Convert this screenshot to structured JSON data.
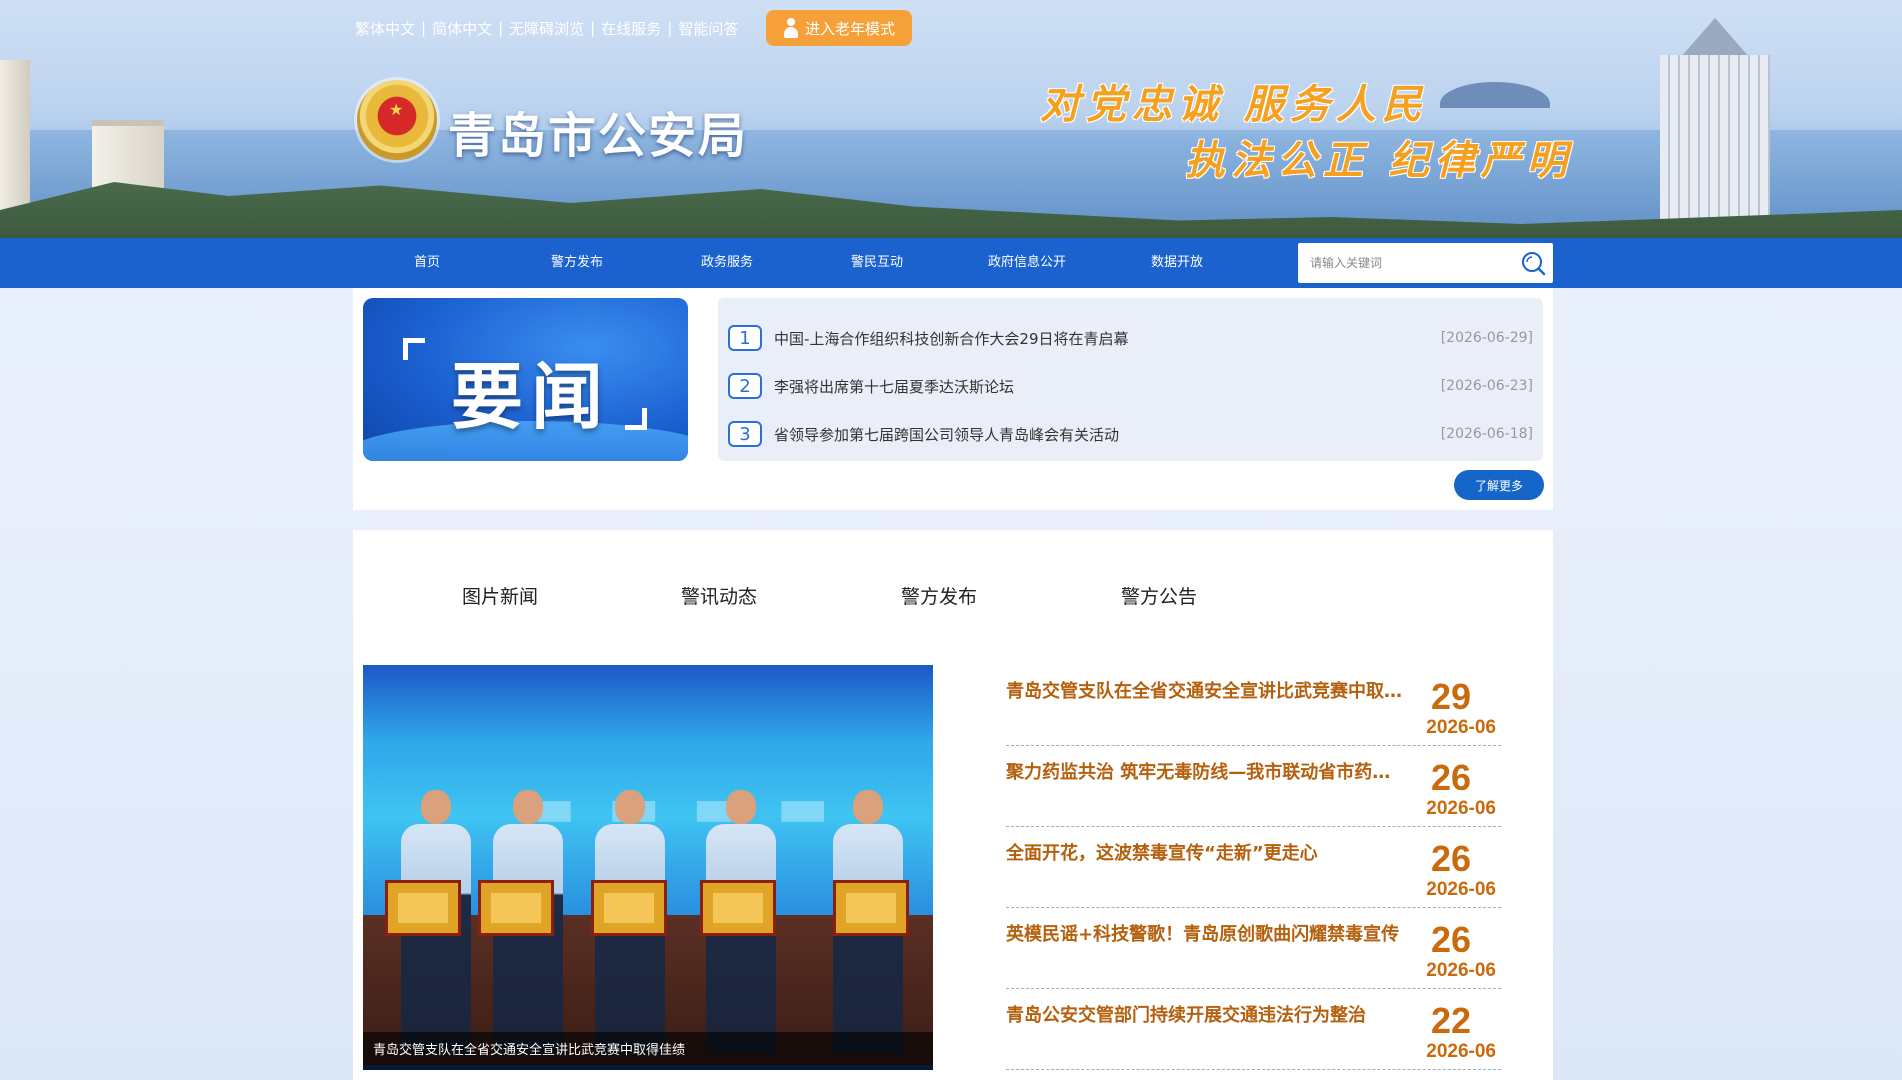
{
  "header": {
    "top_links": [
      "繁体中文",
      "简体中文",
      "无障碍浏览",
      "在线服务",
      "智能问答"
    ],
    "elder_mode_label": "进入老年模式",
    "site_title": "青岛市公安局",
    "slogan_line1": "对党忠诚  服务人民",
    "slogan_line2": "执法公正  纪律严明"
  },
  "nav": {
    "items": [
      "首页",
      "警方发布",
      "政务服务",
      "警民互动",
      "政府信息公开",
      "数据开放"
    ],
    "search_placeholder": "请输入关键词"
  },
  "headline": {
    "badge_text": "要闻",
    "items": [
      {
        "num": "1",
        "title": "中国-上海合作组织科技创新合作大会29日将在青启幕",
        "date": "[2026-06-29]"
      },
      {
        "num": "2",
        "title": "李强将出席第十七届夏季达沃斯论坛",
        "date": "[2026-06-23]"
      },
      {
        "num": "3",
        "title": "省领导参加第七届跨国公司领导人青岛峰会有关活动",
        "date": "[2026-06-18]"
      }
    ],
    "more_label": "了解更多"
  },
  "news": {
    "tabs": [
      "图片新闻",
      "警讯动态",
      "警方发布",
      "警方公告"
    ],
    "photo_caption": "青岛交管支队在全省交通安全宣讲比武竞赛中取得佳绩",
    "items": [
      {
        "title": "青岛交管支队在全省交通安全宣讲比武竞赛中取得佳绩",
        "day": "29",
        "ym": "2026-06"
      },
      {
        "title": "聚力药监共治 筑牢无毒防线—我市联动省市药监部门开展禁毒宣传",
        "day": "26",
        "ym": "2026-06"
      },
      {
        "title": "全面开花，这波禁毒宣传“走新”更走心",
        "day": "26",
        "ym": "2026-06"
      },
      {
        "title": "英模民谣+科技警歌！青岛原创歌曲闪耀禁毒宣传",
        "day": "26",
        "ym": "2026-06"
      },
      {
        "title": "青岛公安交管部门持续开展交通违法行为整治",
        "day": "22",
        "ym": "2026-06"
      }
    ]
  },
  "colors": {
    "nav_blue": "#1b62cf",
    "accent_orange": "#f6a03a",
    "news_title_brown": "#b5600d"
  }
}
